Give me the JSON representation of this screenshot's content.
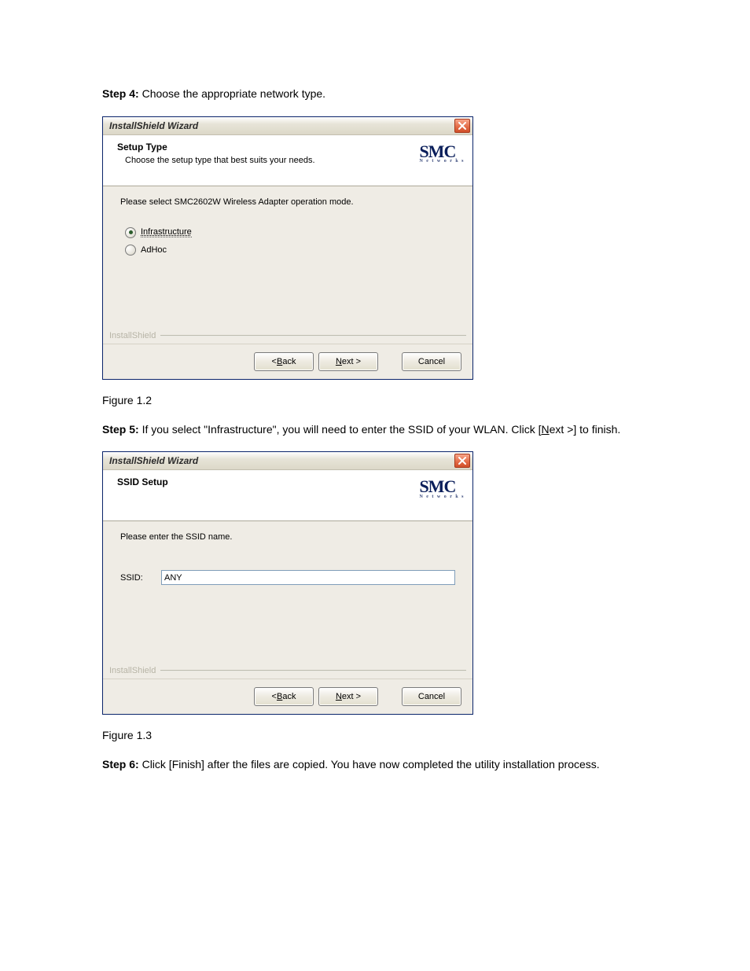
{
  "step4": {
    "label": "Step 4:",
    "text": " Choose the appropriate network type."
  },
  "figure12": "Figure 1.2",
  "step5": {
    "label": "Step 5:",
    "text_a": " If you select \"Infrastructure\", you will need to enter the SSID of your WLAN. Click [",
    "next_u": "N",
    "next_rest": "ext >] to finish."
  },
  "figure13": "Figure 1.3",
  "step6": {
    "label": "Step 6:",
    "text": " Click [Finish] after the files are copied. You have now completed the utility installation process."
  },
  "dialog1": {
    "title": "InstallShield Wizard",
    "header_title": "Setup Type",
    "header_sub": "Choose the setup type that best suits your needs.",
    "logo_main": "SMC",
    "logo_sub": "N e t w o r k s",
    "prompt": "Please select SMC2602W Wireless Adapter operation mode.",
    "radio1": "Infrastructure",
    "radio2": "AdHoc",
    "watermark": "InstallShield",
    "back_u": "B",
    "back_rest": "ack",
    "back_prefix": "< ",
    "next_u": "N",
    "next_rest": "ext >",
    "cancel": "Cancel"
  },
  "dialog2": {
    "title": "InstallShield Wizard",
    "header_title": "SSID Setup",
    "header_sub": "",
    "logo_main": "SMC",
    "logo_sub": "N e t w o r k s",
    "prompt": "Please enter the SSID name.",
    "ssid_label": "SSID:",
    "ssid_value": "ANY",
    "watermark": "InstallShield",
    "back_u": "B",
    "back_rest": "ack",
    "back_prefix": "< ",
    "next_u": "N",
    "next_rest": "ext >",
    "cancel": "Cancel"
  }
}
